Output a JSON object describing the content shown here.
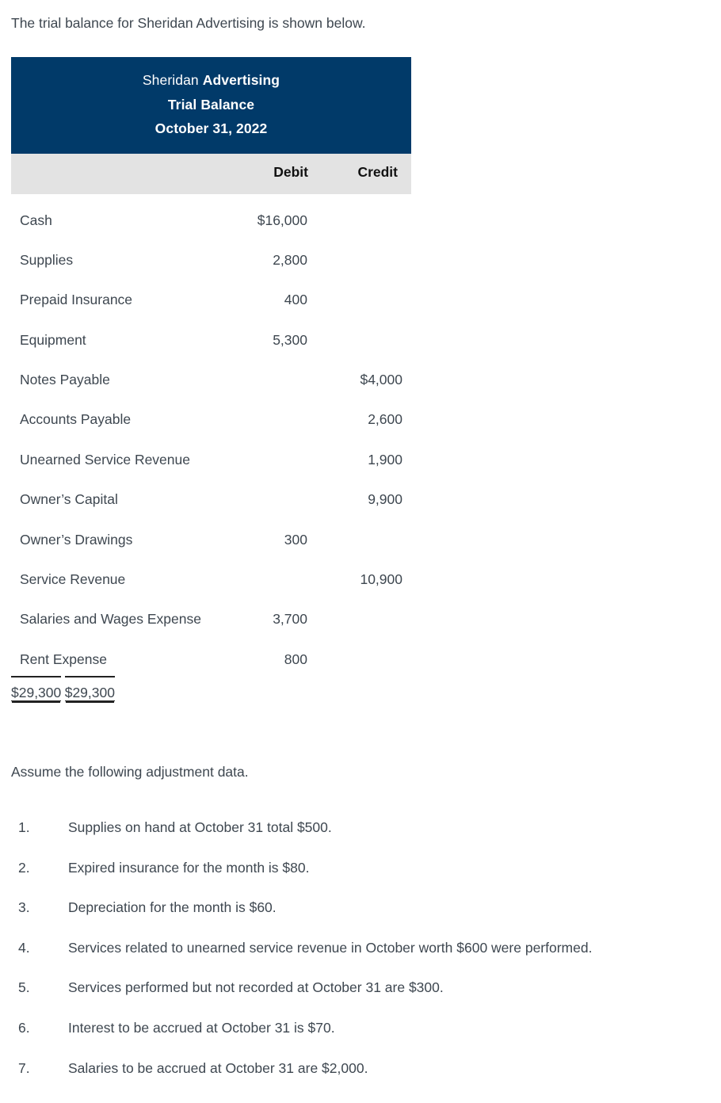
{
  "intro": "The trial balance for Sheridan Advertising is shown below.",
  "trial_balance": {
    "title": {
      "company_regular": "Sheridan ",
      "company_bold": "Advertising",
      "statement": "Trial Balance",
      "date": "October 31, 2022"
    },
    "columns": {
      "account": "",
      "debit": "Debit",
      "credit": "Credit"
    },
    "rows": [
      {
        "account": "Cash",
        "debit": "$16,000",
        "credit": ""
      },
      {
        "account": "Supplies",
        "debit": "2,800",
        "credit": ""
      },
      {
        "account": "Prepaid Insurance",
        "debit": "400",
        "credit": ""
      },
      {
        "account": "Equipment",
        "debit": "5,300",
        "credit": ""
      },
      {
        "account": "Notes Payable",
        "debit": "",
        "credit": "$4,000"
      },
      {
        "account": "Accounts Payable",
        "debit": "",
        "credit": "2,600"
      },
      {
        "account": "Unearned Service Revenue",
        "debit": "",
        "credit": "1,900"
      },
      {
        "account": "Owner’s Capital",
        "debit": "",
        "credit": "9,900"
      },
      {
        "account": "Owner’s Drawings",
        "debit": "300",
        "credit": ""
      },
      {
        "account": "Service Revenue",
        "debit": "",
        "credit": "10,900"
      },
      {
        "account": "Salaries and Wages Expense",
        "debit": "3,700",
        "credit": ""
      },
      {
        "account": "Rent Expense",
        "debit": "800",
        "credit": ""
      }
    ],
    "totals": {
      "account": "",
      "debit": "$29,300",
      "credit": "$29,300"
    }
  },
  "adjustments": {
    "heading": "Assume the following adjustment data.",
    "items": [
      {
        "number": "1.",
        "text": "Supplies on hand at October 31 total $500."
      },
      {
        "number": "2.",
        "text": "Expired insurance for the month is $80."
      },
      {
        "number": "3.",
        "text": "Depreciation for the month is $60."
      },
      {
        "number": "4.",
        "text": "Services related to unearned service revenue in October worth $600 were performed."
      },
      {
        "number": "5.",
        "text": "Services performed but not recorded at October 31 are $300."
      },
      {
        "number": "6.",
        "text": "Interest to be accrued at October 31 is $70."
      },
      {
        "number": "7.",
        "text": "Salaries to be accrued at October 31 are $2,000."
      }
    ]
  },
  "colors": {
    "header_blue": "#013a69",
    "column_header_gray": "#e3e3e3",
    "body_text": "#3e4750"
  }
}
